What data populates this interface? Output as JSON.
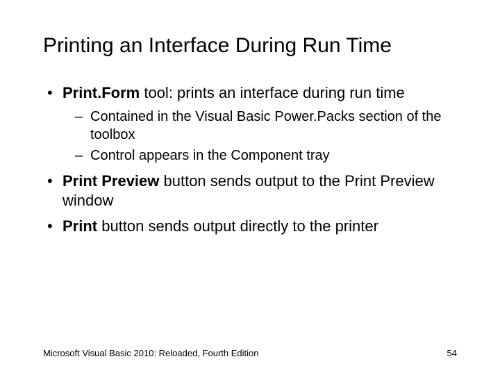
{
  "title": "Printing an Interface During Run Time",
  "bullets": {
    "b1_bold": "Print.Form",
    "b1_rest": " tool: prints an interface during run time",
    "b1_s1": "Contained in the Visual Basic Power.Packs section of the toolbox",
    "b1_s2": "Control appears in the Component tray",
    "b2_bold": "Print Preview",
    "b2_rest": " button sends output to the Print Preview window",
    "b3_bold": "Print",
    "b3_rest": " button sends output directly to the printer"
  },
  "footer": {
    "left": "Microsoft Visual Basic 2010: Reloaded, Fourth Edition",
    "right": "54"
  }
}
